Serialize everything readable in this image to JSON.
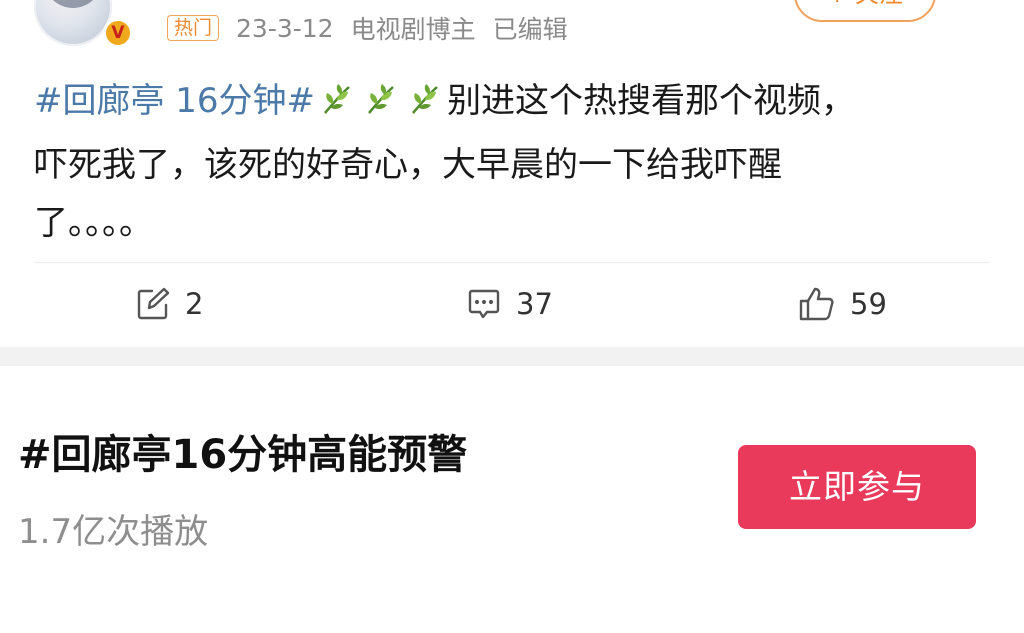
{
  "post": {
    "hot_tag": "热门",
    "date": "23-3-12",
    "author_title": "电视剧博主",
    "edited": "已编辑",
    "follow_label": "+ 关注",
    "hashtag": "#回廊亭 16分钟#",
    "text_line1": "别进这个热搜看那个视频，",
    "text_line2": "吓死我了，该死的好奇心，大早晨的一下给我吓醒",
    "text_line3": "了。。。。"
  },
  "actions": {
    "repost_count": "2",
    "comment_count": "37",
    "like_count": "59"
  },
  "topic": {
    "title": "#回廊亭16分钟高能预警",
    "plays": "1.7亿次播放",
    "join_label": "立即参与"
  },
  "icons": {
    "verified": "verified-badge-icon",
    "leaf": "herb-emoji-icon",
    "repost": "repost-icon",
    "comment": "comment-icon",
    "like": "thumbs-up-icon"
  },
  "colors": {
    "hashtag": "#4b79a8",
    "hot_tag": "#ee8a2f",
    "join_button": "#ea3a5c"
  }
}
